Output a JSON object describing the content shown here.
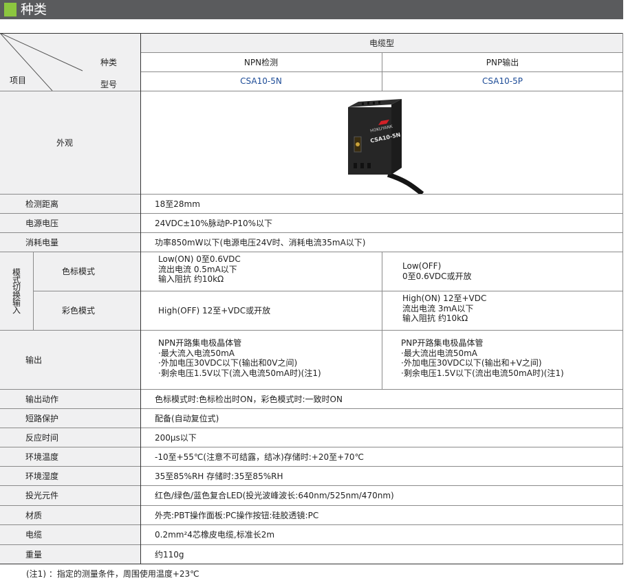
{
  "section_title": "种类",
  "header": {
    "item_label": "项目",
    "type_label": "种类",
    "model_label": "型号",
    "cable_type": "电缆型",
    "npn_type": "NPN检测",
    "pnp_type": "PNP输出",
    "npn_model": "CSA10-5N",
    "pnp_model": "CSA10-5P"
  },
  "appearance": {
    "label": "外观",
    "product_brand": "HOKUYANK",
    "product_model": "CSA10-5N"
  },
  "rows": {
    "detect_distance": {
      "label": "检测距离",
      "value": "18至28mm"
    },
    "supply_voltage": {
      "label": "电源电压",
      "value": "24VDC±10%脉动P-P10%以下"
    },
    "power_consumption": {
      "label": "消耗电量",
      "value": "功率850mW以下(电源电压24V时、消耗电流35mA以下)"
    },
    "output_action": {
      "label": "输出动作",
      "value": "色标模式时:色标检出时ON，彩色模式时:一致时ON"
    },
    "short_protection": {
      "label": "短路保护",
      "value": "配备(自动复位式)"
    },
    "response_time": {
      "label": "反应时间",
      "value": "200μs以下"
    },
    "ambient_temp": {
      "label": "环境温度",
      "value": "-10至+55℃(注意不可结露，结冰)存储时:+20至+70℃"
    },
    "ambient_humidity": {
      "label": "环境湿度",
      "value": "35至85%RH 存储时:35至85%RH"
    },
    "light_element": {
      "label": "投光元件",
      "value": "红色/绿色/蓝色复合LED(投光波峰波长:640nm/525nm/470nm)"
    },
    "material": {
      "label": "材质",
      "value": "外壳:PBT操作面板:PC操作按钮:硅胶透镜:PC"
    },
    "cable": {
      "label": "电缆",
      "value": "0.2mm²4芯橡皮电缆,标准长2m"
    },
    "weight": {
      "label": "重量",
      "value": "约110g"
    }
  },
  "mode_input": {
    "group_label": "模式切换输入",
    "mark_mode": {
      "label": "色标模式",
      "npn": [
        "Low(ON) 0至0.6VDC",
        "流出电流  0.5mA以下",
        "输入阻抗  约10kΩ"
      ],
      "pnp": [
        "Low(OFF)",
        "0至0.6VDC或开放"
      ]
    },
    "color_mode": {
      "label": "彩色模式",
      "npn": [
        "High(OFF) 12至+VDC或开放"
      ],
      "pnp": [
        "High(ON) 12至+VDC",
        "流出电流     3mA以下",
        "输入阻抗     约10kΩ"
      ]
    }
  },
  "output": {
    "label": "输出",
    "npn": [
      "NPN开路集电极晶体管",
      "·最大流入电流50mA",
      "·外加电压30VDC以下(输出和0V之间)",
      "·剩余电压1.5V以下(流入电流50mA时)(注1)"
    ],
    "pnp": [
      "PNP开路集电极晶体管",
      "·最大流出电流50mA",
      "·外加电压30VDC以下(输出和+V之间)",
      "·剩余电压1.5V以下(流出电流50mA时)(注1)"
    ]
  },
  "footnote": "(注1) ：指定的测量条件，周围使用温度+23℃"
}
